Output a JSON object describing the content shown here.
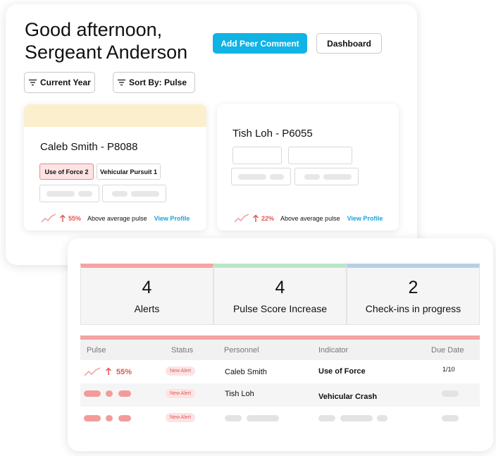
{
  "header": {
    "greeting_line1": "Good afternoon,",
    "greeting_line2": "Sergeant Anderson",
    "add_comment_label": "Add Peer Comment",
    "dashboard_label": "Dashboard"
  },
  "filters": {
    "year_label": "Current Year",
    "sort_label": "Sort By: Pulse"
  },
  "cards": [
    {
      "title": "Caleb Smith - P8088",
      "tags": [
        "Use of Force 2",
        "Vehicular Pursuit 1"
      ],
      "trend_pct": "55%",
      "pulse_text": "Above average pulse",
      "link_label": "View Profile",
      "highlight_color": "#fcefcd"
    },
    {
      "title": "Tish Loh - P6055",
      "trend_pct": "22%",
      "pulse_text": "Above average pulse",
      "link_label": "View Profile"
    }
  ],
  "stats": [
    {
      "value": "4",
      "label": "Alerts",
      "color": "#f5a3a3"
    },
    {
      "value": "4",
      "label": "Pulse Score Increase",
      "color": "#b9e6c8"
    },
    {
      "value": "2",
      "label": "Check-ins in progress",
      "color": "#b8cfe3"
    }
  ],
  "table": {
    "columns": [
      "Pulse",
      "Status",
      "Personnel",
      "Indicator",
      "Due Date"
    ],
    "rows": [
      {
        "pulse": "55%",
        "status": "New Alert",
        "personnel": "Caleb Smith",
        "indicator": "Use of Force",
        "due": "1/10"
      },
      {
        "status": "New Alert",
        "personnel": "Tish Loh",
        "indicator": "Vehicular Crash"
      },
      {
        "status": "New Alert"
      }
    ]
  },
  "colors": {
    "primary": "#10b3e3",
    "trend_red": "#e25656",
    "link_blue": "#1ea3d6"
  }
}
